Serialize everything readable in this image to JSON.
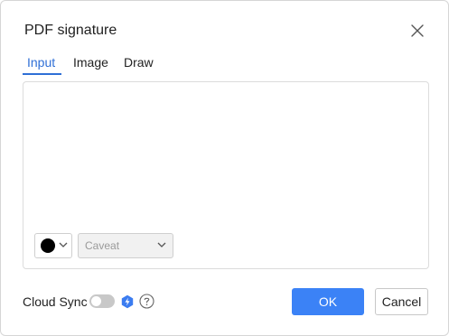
{
  "dialog": {
    "title": "PDF signature",
    "close_icon": "close-icon"
  },
  "tabs": [
    {
      "label": "Input",
      "active": true
    },
    {
      "label": "Image",
      "active": false
    },
    {
      "label": "Draw",
      "active": false
    }
  ],
  "editor": {
    "color": "#000000",
    "font_value": "Caveat"
  },
  "footer": {
    "cloud_sync_label": "Cloud Sync",
    "cloud_sync_on": false,
    "ok_label": "OK",
    "cancel_label": "Cancel"
  },
  "colors": {
    "accent": "#2f6fd6",
    "ok_button": "#3b82f6",
    "premium_badge": "#3b7cf0"
  }
}
